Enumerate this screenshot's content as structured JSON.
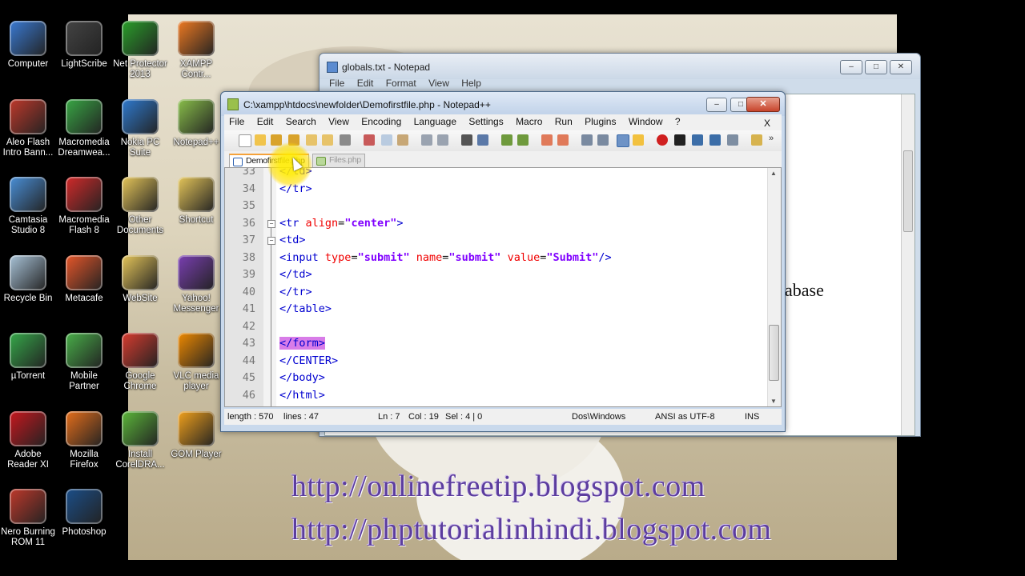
{
  "desktop": {
    "icons": [
      {
        "label": "Computer",
        "icon": "computer-icon",
        "color": "#3a7bd5"
      },
      {
        "label": "LightScribe",
        "icon": "lightscribe-icon",
        "color": "#444444"
      },
      {
        "label": "Net Protector 2013",
        "icon": "net-protector-icon",
        "color": "#2aa02a"
      },
      {
        "label": "XAMPP Contr...",
        "icon": "xampp-icon",
        "color": "#f07a22"
      },
      {
        "label": "Aleo Flash Intro Bann...",
        "icon": "aleo-flash-icon",
        "color": "#c0392b"
      },
      {
        "label": "Macromedia Dreamwea...",
        "icon": "dreamweaver-icon",
        "color": "#39a845"
      },
      {
        "label": "Nokia PC Suite",
        "icon": "nokia-pc-suite-icon",
        "color": "#2f7bd1"
      },
      {
        "label": "Notepad++",
        "icon": "notepadpp-icon",
        "color": "#8ac04a"
      },
      {
        "label": "Camtasia Studio 8",
        "icon": "camtasia-icon",
        "color": "#4a90d9"
      },
      {
        "label": "Macromedia Flash 8",
        "icon": "flash-icon",
        "color": "#d42a2a"
      },
      {
        "label": "Other Documents",
        "icon": "folder-icon",
        "color": "#e7c75a"
      },
      {
        "label": "Shortcut",
        "icon": "shortcut-folder-icon",
        "color": "#e7c75a"
      },
      {
        "label": "Recycle Bin",
        "icon": "recycle-bin-icon",
        "color": "#a9c4d9"
      },
      {
        "label": "Metacafe",
        "icon": "metacafe-icon",
        "color": "#e8572a"
      },
      {
        "label": "WebSite",
        "icon": "website-folder-icon",
        "color": "#e7c75a"
      },
      {
        "label": "Yahoo! Messenger",
        "icon": "yahoo-messenger-icon",
        "color": "#7b3fb3"
      },
      {
        "label": "µTorrent",
        "icon": "utorrent-icon",
        "color": "#36a94a"
      },
      {
        "label": "Mobile Partner",
        "icon": "mobile-partner-icon",
        "color": "#49b049"
      },
      {
        "label": "Google Chrome",
        "icon": "chrome-icon",
        "color": "#d93c2f"
      },
      {
        "label": "VLC media player",
        "icon": "vlc-icon",
        "color": "#f08a00"
      },
      {
        "label": "Adobe Reader XI",
        "icon": "adobe-reader-icon",
        "color": "#c8171e"
      },
      {
        "label": "Mozilla Firefox",
        "icon": "firefox-icon",
        "color": "#e76f1b"
      },
      {
        "label": "Install CorelDRA...",
        "icon": "coreldraw-icon",
        "color": "#5cb83a"
      },
      {
        "label": "GOM Player",
        "icon": "gom-player-icon",
        "color": "#f3a21c"
      },
      {
        "label": "Nero Burning ROM 11",
        "icon": "nero-icon",
        "color": "#c0392b"
      },
      {
        "label": "Photoshop",
        "icon": "photoshop-icon",
        "color": "#1b4f8a"
      }
    ]
  },
  "notepad": {
    "title": "globals.txt - Notepad",
    "menu": [
      "File",
      "Edit",
      "Format",
      "View",
      "Help"
    ],
    "visible_text": "abase"
  },
  "npp": {
    "title": "C:\\xampp\\htdocs\\newfolder\\Demofirstfile.php - Notepad++",
    "menu": [
      "File",
      "Edit",
      "Search",
      "View",
      "Encoding",
      "Language",
      "Settings",
      "Macro",
      "Run",
      "Plugins",
      "Window",
      "?"
    ],
    "menu_close": "X",
    "tabs": [
      "Demofirstfile.php",
      "Files.php"
    ],
    "lines": [
      {
        "n": "33",
        "code": "</td>"
      },
      {
        "n": "34",
        "code": "</tr>"
      },
      {
        "n": "35",
        "code": ""
      },
      {
        "n": "36",
        "code": "<tr align=\"center\">"
      },
      {
        "n": "37",
        "code": "<td>"
      },
      {
        "n": "38",
        "code": "<input type=\"submit\" name=\"submit\" value=\"Submit\"/>"
      },
      {
        "n": "39",
        "code": "</td>"
      },
      {
        "n": "40",
        "code": "</tr>"
      },
      {
        "n": "41",
        "code": "</table>"
      },
      {
        "n": "42",
        "code": ""
      },
      {
        "n": "43",
        "code": "</form>"
      },
      {
        "n": "44",
        "code": "</CENTER>"
      },
      {
        "n": "45",
        "code": "</body>"
      },
      {
        "n": "46",
        "code": "</html>"
      }
    ],
    "status": {
      "length": "length : 570",
      "lines": "lines : 47",
      "ln": "Ln : 7",
      "col": "Col : 19",
      "sel": "Sel : 4 | 0",
      "eol": "Dos\\Windows",
      "encoding": "ANSI as UTF-8",
      "mode": "INS"
    }
  },
  "watermark": {
    "line1": "http://onlinefreetip.blogspot.com",
    "line2": "http://phptutorialinhindi.blogspot.com"
  }
}
